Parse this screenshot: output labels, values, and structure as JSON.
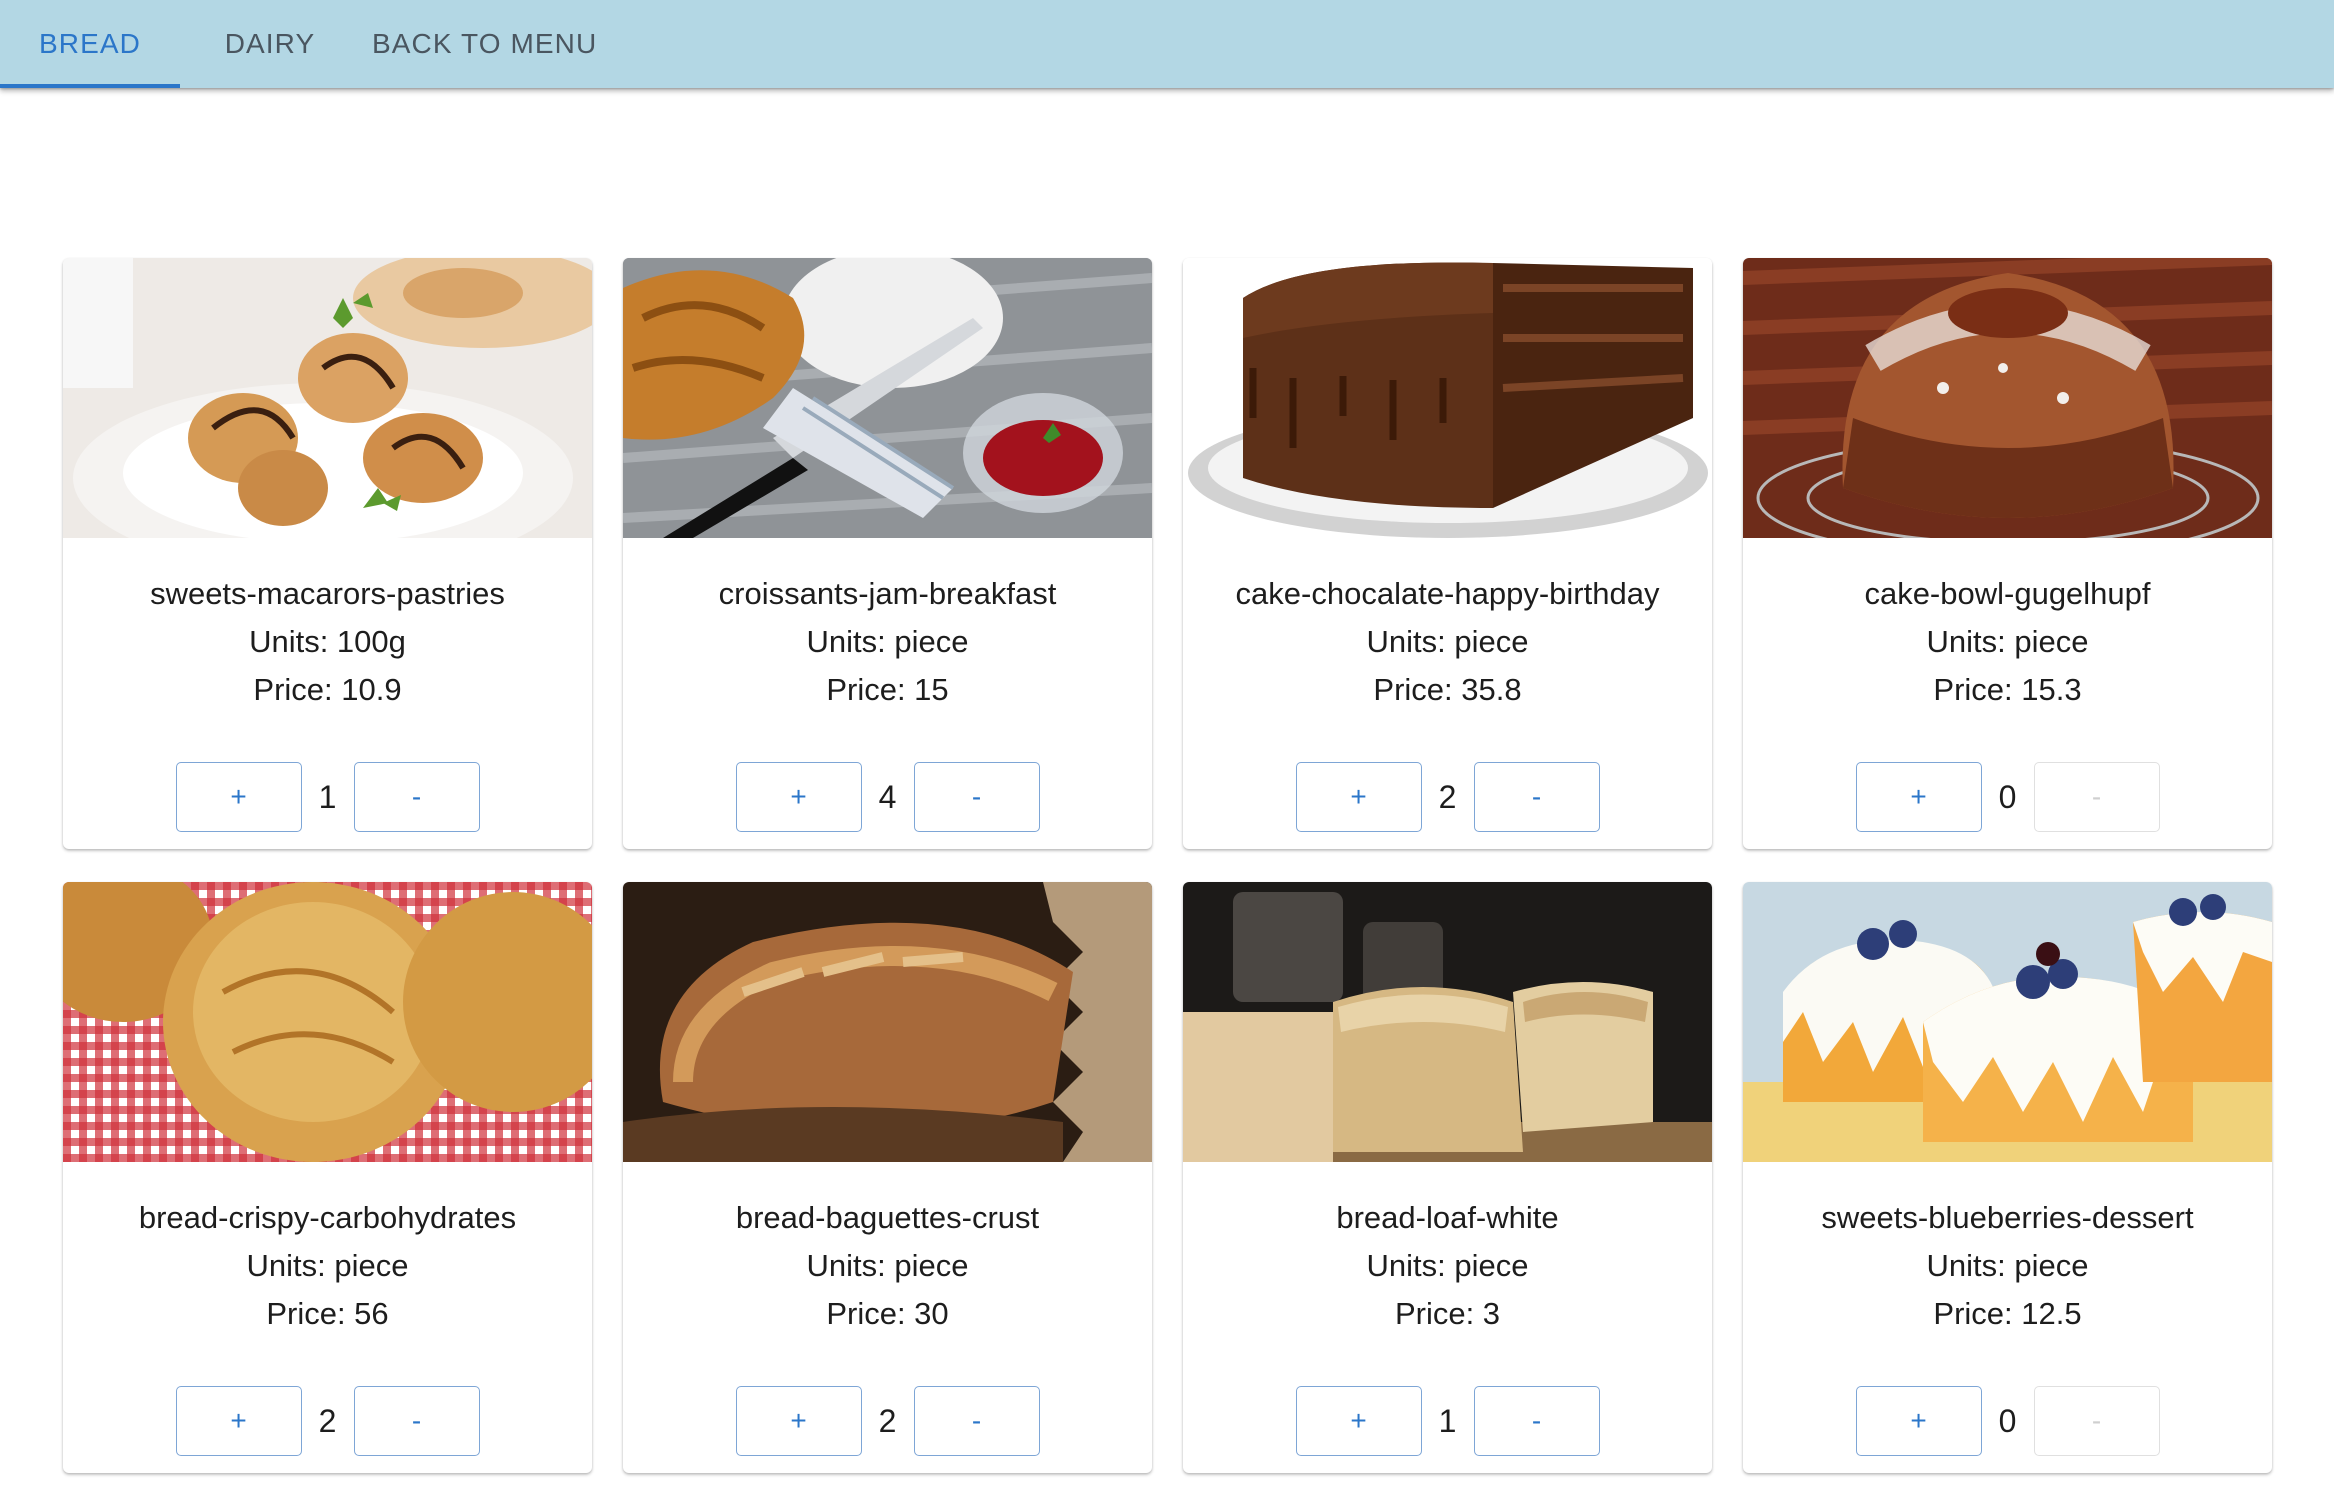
{
  "tabs": [
    {
      "label": "BREAD",
      "active": true
    },
    {
      "label": "DAIRY",
      "active": false
    },
    {
      "label": "BACK TO MENU",
      "active": false
    }
  ],
  "colors": {
    "appbar": "#b3d7e4",
    "accent": "#2b76c9"
  },
  "products": [
    {
      "name": "sweets-macarors-pastries",
      "units": "Units: 100g",
      "price": "Price: 10.9",
      "qty": "1",
      "plus": "+",
      "minus": "-",
      "minus_disabled": false,
      "image": "cream-puff-pastries-image"
    },
    {
      "name": "croissants-jam-breakfast",
      "units": "Units: piece",
      "price": "Price: 15",
      "qty": "4",
      "plus": "+",
      "minus": "-",
      "minus_disabled": false,
      "image": "croissant-jam-image"
    },
    {
      "name": "cake-chocalate-happy-birthday",
      "units": "Units: piece",
      "price": "Price: 35.8",
      "qty": "2",
      "plus": "+",
      "minus": "-",
      "minus_disabled": false,
      "image": "chocolate-cake-image"
    },
    {
      "name": "cake-bowl-gugelhupf",
      "units": "Units: piece",
      "price": "Price: 15.3",
      "qty": "0",
      "plus": "+",
      "minus": "-",
      "minus_disabled": true,
      "image": "gugelhupf-cake-image"
    },
    {
      "name": "bread-crispy-carbohydrates",
      "units": "Units: piece",
      "price": "Price: 56",
      "qty": "2",
      "plus": "+",
      "minus": "-",
      "minus_disabled": false,
      "image": "bread-rolls-image"
    },
    {
      "name": "bread-baguettes-crust",
      "units": "Units: piece",
      "price": "Price: 30",
      "qty": "2",
      "plus": "+",
      "minus": "-",
      "minus_disabled": false,
      "image": "baguette-image"
    },
    {
      "name": "bread-loaf-white",
      "units": "Units: piece",
      "price": "Price: 3",
      "qty": "1",
      "plus": "+",
      "minus": "-",
      "minus_disabled": false,
      "image": "white-loaf-image"
    },
    {
      "name": "sweets-blueberries-dessert",
      "units": "Units: piece",
      "price": "Price: 12.5",
      "qty": "0",
      "plus": "+",
      "minus": "-",
      "minus_disabled": true,
      "image": "blueberry-dessert-image"
    }
  ]
}
